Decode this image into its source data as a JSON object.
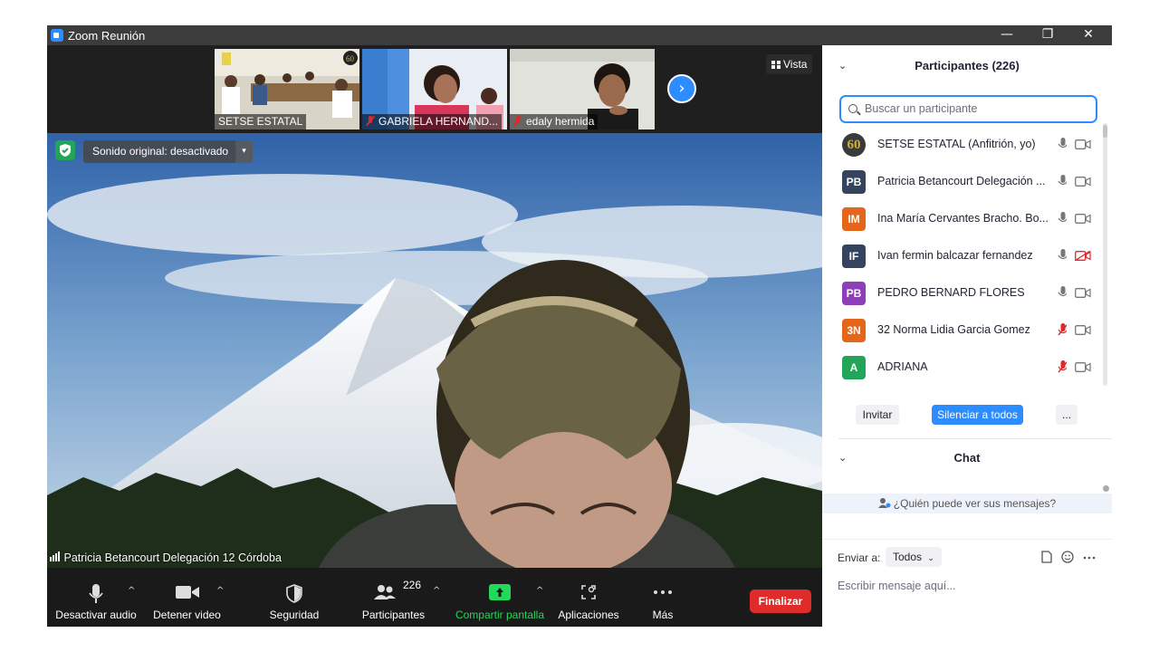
{
  "window": {
    "title": "Zoom Reunión",
    "controls": [
      "—",
      "❐",
      "✕"
    ]
  },
  "thumbnails": [
    {
      "name": "SETSE ESTATAL",
      "muted": false
    },
    {
      "name": "GABRIELA HERNAND...",
      "muted": true
    },
    {
      "name": "edaly hermida",
      "muted": true
    }
  ],
  "view_label": "Vista",
  "sound_original": "Sonido original: desactivado",
  "active_speaker": "Patricia Betancourt Delegación 12 Córdoba",
  "toolbar": {
    "audio": "Desactivar audio",
    "video": "Detener video",
    "security": "Seguridad",
    "participants": "Participantes",
    "participants_count": "226",
    "share": "Compartir pantalla",
    "apps": "Aplicaciones",
    "more": "Más",
    "end": "Finalizar"
  },
  "participants_panel": {
    "title": "Participantes (226)",
    "search_placeholder": "Buscar un participante",
    "people": [
      {
        "initials": "60",
        "name": "SETSE ESTATAL (Anfitrión, yo)",
        "color": "#3a3a3a",
        "mic_muted": false,
        "cam_off": false
      },
      {
        "initials": "PB",
        "name": "Patricia Betancourt Delegación ...",
        "color": "#34435e",
        "mic_muted": false,
        "cam_off": false
      },
      {
        "initials": "IM",
        "name": "Ina María Cervantes Bracho. Bo...",
        "color": "#e4661b",
        "mic_muted": false,
        "cam_off": false
      },
      {
        "initials": "IF",
        "name": "Ivan fermin balcazar fernandez",
        "color": "#34435e",
        "mic_muted": false,
        "cam_off": true
      },
      {
        "initials": "PB",
        "name": "PEDRO BERNARD FLORES",
        "color": "#8e3fb8",
        "mic_muted": false,
        "cam_off": false
      },
      {
        "initials": "3N",
        "name": "32 Norma Lidia Garcia Gomez",
        "color": "#e4661b",
        "mic_muted": true,
        "cam_off": false
      },
      {
        "initials": "A",
        "name": "ADRIANA",
        "color": "#23a559",
        "mic_muted": true,
        "cam_off": false
      }
    ],
    "invite": "Invitar",
    "mute_all": "Silenciar a todos",
    "more": "..."
  },
  "chat": {
    "title": "Chat",
    "who_can_see": "¿Quién puede ver sus mensajes?",
    "send_to_label": "Enviar a:",
    "send_to_value": "Todos",
    "input_placeholder": "Escribir mensaje aquí..."
  },
  "colors": {
    "accent": "#2d8cff",
    "end": "#e02b2b",
    "share": "#23d959",
    "muted": "#e02828"
  }
}
